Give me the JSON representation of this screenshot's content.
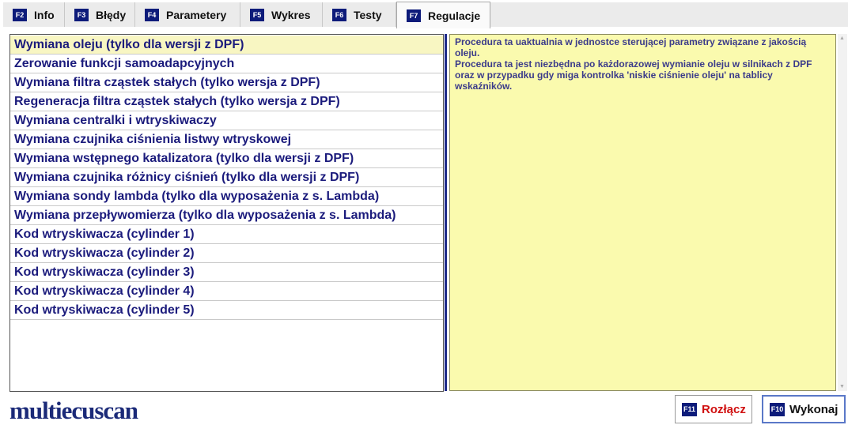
{
  "tabs": [
    {
      "key": "F2",
      "label": "Info"
    },
    {
      "key": "F3",
      "label": "Błędy"
    },
    {
      "key": "F4",
      "label": "Parametery"
    },
    {
      "key": "F5",
      "label": "Wykres"
    },
    {
      "key": "F6",
      "label": "Testy"
    },
    {
      "key": "F7",
      "label": "Regulacje"
    }
  ],
  "active_tab": "Regulacje",
  "procedures": [
    "Wymiana oleju (tylko dla wersji z DPF)",
    "Zerowanie funkcji samoadapcyjnych",
    "Wymiana filtra cząstek stałych (tylko wersja z DPF)",
    "Regeneracja filtra cząstek stałych (tylko wersja z DPF)",
    "Wymiana centralki i wtryskiwaczy",
    "Wymiana czujnika ciśnienia listwy wtryskowej",
    "Wymiana wstępnego katalizatora (tylko dla wersji z DPF)",
    "Wymiana czujnika różnicy ciśnień (tylko dla wersji z DPF)",
    "Wymiana sondy lambda (tylko dla wyposażenia z s. Lambda)",
    "Wymiana przepływomierza (tylko dla wyposażenia z s. Lambda)",
    "Kod wtryskiwacza (cylinder 1)",
    "Kod wtryskiwacza (cylinder 2)",
    "Kod wtryskiwacza (cylinder 3)",
    "Kod wtryskiwacza (cylinder 4)",
    "Kod wtryskiwacza (cylinder 5)"
  ],
  "selected_procedure": "Wymiana oleju (tylko dla wersji z DPF)",
  "description": {
    "line1": "Procedura ta uaktualnia w jednostce sterującej parametry związane z jakością oleju.",
    "line2": "Procedura ta jest niezbędna po każdorazowej wymianie oleju w silnikach z DPF oraz w przypadku gdy miga kontrolka 'niskie ciśnienie oleju' na tablicy wskaźników."
  },
  "logo": "multiecuscan",
  "buttons": {
    "disconnect": {
      "key": "F11",
      "label": "Rozłącz"
    },
    "execute": {
      "key": "F10",
      "label": "Wykonaj"
    }
  },
  "colors": {
    "key_badge": "#0d1b7a",
    "list_text": "#1b1b7c",
    "selected_row": "#f8f6c2",
    "desc_bg": "#fafaae",
    "disconnect_text": "#d01010"
  }
}
